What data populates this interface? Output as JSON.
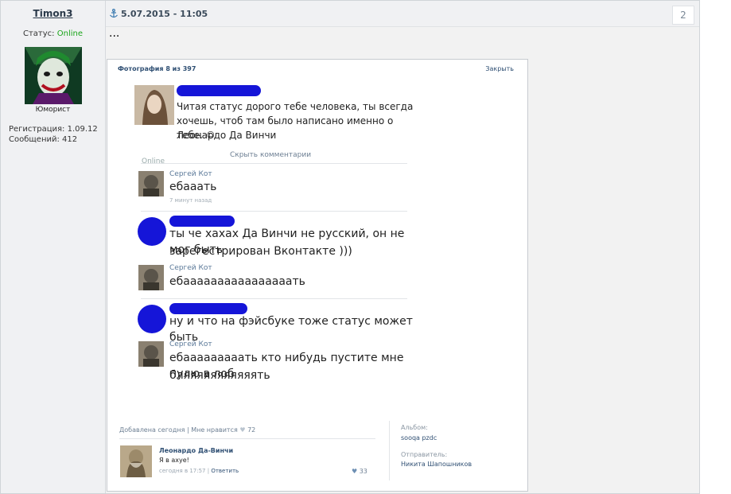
{
  "author": {
    "username": "Timon3",
    "status_label": "Статус:",
    "status_value": "Online",
    "rank": "Юморист",
    "registration": "Регистрация: 1.09.12",
    "messages": "Сообщений: 412"
  },
  "post": {
    "date": "5.07.2015 - 11:05",
    "number": "2",
    "text": "..."
  },
  "photo": {
    "counter": "Фотография 8 из 397",
    "close": "Закрыть",
    "status_text_1": "Читая статус дорого тебе человека, ты всегда",
    "status_text_2": "хочешь, чтоб там было написано именно о тебе. ©",
    "status_text_3": "Леонардо Да Винчи",
    "online": "Online",
    "hide_comments": "Скрыть комментарии",
    "comments": [
      {
        "name": "Сергей Кот",
        "lines": [
          "ебааать"
        ],
        "time": "7 минут назад"
      },
      {
        "name": "",
        "lines": [
          "ты че хахах Да Винчи не русский, он не мог быть",
          "зарегестрирован Вконтакте )))"
        ],
        "time": ""
      },
      {
        "name": "Сергей Кот",
        "lines": [
          "ебаааааааааааааааать"
        ],
        "time": ""
      },
      {
        "name": "",
        "lines": [
          "ну и что на фэйсбуке тоже статус может быть"
        ],
        "time": ""
      },
      {
        "name": "Сергей Кот",
        "lines": [
          "ебааааааааать кто нибудь пустите мне пулю в лоб",
          "бляяяяяяяяяяять"
        ],
        "time": ""
      }
    ],
    "footer": {
      "added": "Добавлена сегодня",
      "like": "Мне нравится",
      "like_count": "72",
      "album_label": "Альбом:",
      "album_value": "sooqa pzdc",
      "sender_label": "Отправитель:",
      "sender_value": "Никита Шапошников"
    },
    "comment": {
      "name": "Леонардо Да-Винчи",
      "text": "Я в ахуе!",
      "time": "сегодня в 17:57",
      "reply": "Ответить",
      "likes": "33"
    }
  }
}
